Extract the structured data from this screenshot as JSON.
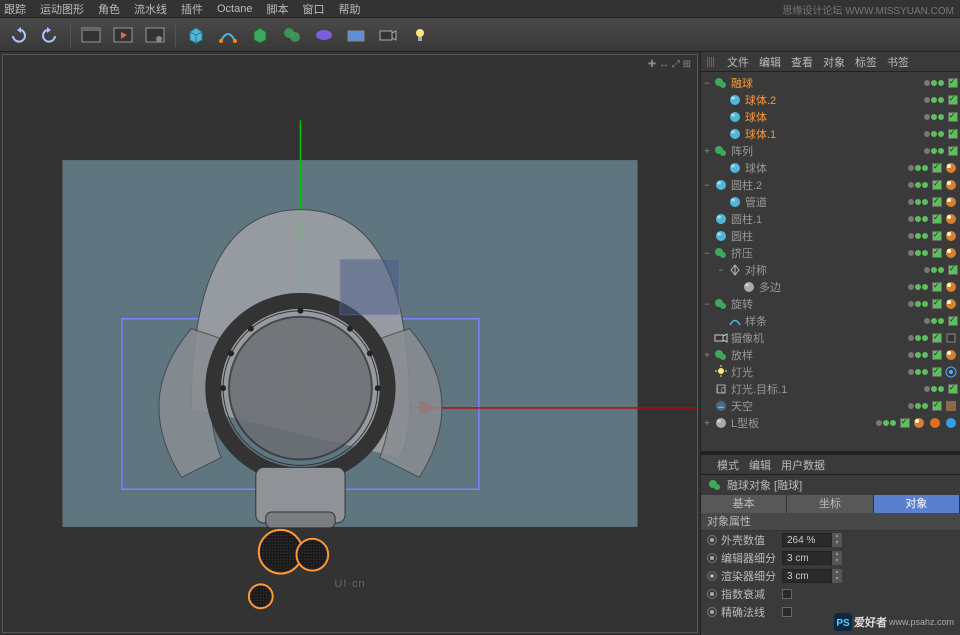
{
  "menu": [
    "跟踪",
    "运动图形",
    "角色",
    "流水线",
    "插件",
    "Octane",
    "脚本",
    "窗口",
    "帮助"
  ],
  "watermarks": {
    "top_right": "思缘设计论坛   WWW.MISSYUAN.COM",
    "bottom_brand": "PS",
    "bottom_text1": "爱好者",
    "bottom_text2": "www.psahz.com",
    "viewport": "UI·cn"
  },
  "viewport_corner": "✚ ↔ ⤢ ⊞",
  "objects_panel": {
    "tabs": [
      "文件",
      "编辑",
      "查看",
      "对象",
      "标签",
      "书签"
    ]
  },
  "tree": [
    {
      "depth": 1,
      "expand": "−",
      "icon": "metaball",
      "label": "融球",
      "sel": true,
      "green": true
    },
    {
      "depth": 2,
      "expand": "",
      "icon": "sphere",
      "label": "球体.2",
      "sel": true,
      "green": true
    },
    {
      "depth": 2,
      "expand": "",
      "icon": "sphere",
      "label": "球体",
      "sel": true,
      "green": true
    },
    {
      "depth": 2,
      "expand": "",
      "icon": "sphere",
      "label": "球体.1",
      "sel": true,
      "green": true
    },
    {
      "depth": 1,
      "expand": "+",
      "icon": "array",
      "label": "阵列",
      "green": true
    },
    {
      "depth": 2,
      "expand": "",
      "icon": "sphere",
      "label": "球体",
      "green": true,
      "tags": [
        "phong"
      ]
    },
    {
      "depth": 1,
      "expand": "−",
      "icon": "cylinder",
      "label": "圆柱.2",
      "green": true,
      "tags": [
        "phong"
      ]
    },
    {
      "depth": 2,
      "expand": "",
      "icon": "cylinder",
      "label": "管道",
      "green": true,
      "tags": [
        "phong"
      ]
    },
    {
      "depth": 1,
      "expand": "",
      "icon": "cylinder",
      "label": "圆柱.1",
      "green": true,
      "tags": [
        "phong"
      ]
    },
    {
      "depth": 1,
      "expand": "",
      "icon": "cylinder",
      "label": "圆柱",
      "green": true,
      "tags": [
        "phong"
      ]
    },
    {
      "depth": 1,
      "expand": "−",
      "icon": "extrude",
      "label": "挤压",
      "green": true,
      "tags": [
        "phong"
      ]
    },
    {
      "depth": 2,
      "expand": "−",
      "icon": "symmetry",
      "label": "对称",
      "green": true
    },
    {
      "depth": 3,
      "expand": "",
      "icon": "poly",
      "label": "多边",
      "green": true,
      "tags": [
        "phong"
      ]
    },
    {
      "depth": 1,
      "expand": "−",
      "icon": "lathe",
      "label": "旋转",
      "green": true,
      "tags": [
        "phong"
      ]
    },
    {
      "depth": 2,
      "expand": "",
      "icon": "spline",
      "label": "样条",
      "green": true
    },
    {
      "depth": 1,
      "expand": "",
      "icon": "camera",
      "label": "摄像机",
      "green": true,
      "tags": [
        "camtag"
      ]
    },
    {
      "depth": 1,
      "expand": "+",
      "icon": "sweep",
      "label": "放样",
      "green": true,
      "tags": [
        "phong"
      ]
    },
    {
      "depth": 1,
      "expand": "",
      "icon": "light",
      "label": "灯光",
      "green": true,
      "tags": [
        "target"
      ]
    },
    {
      "depth": 1,
      "expand": "",
      "icon": "null",
      "label": "灯光.目标.1",
      "green": true
    },
    {
      "depth": 1,
      "expand": "",
      "icon": "sky",
      "label": "天空",
      "green": true,
      "tags": [
        "mat"
      ]
    },
    {
      "depth": 1,
      "expand": "+",
      "icon": "poly",
      "label": "L型板",
      "green": true,
      "tags": [
        "phong",
        "orange",
        "blue"
      ]
    }
  ],
  "attr": {
    "tabs": [
      "模式",
      "编辑",
      "用户数据"
    ],
    "title": "融球对象 [融球]",
    "subtabs": [
      "基本",
      "坐标",
      "对象"
    ],
    "active_subtab": 2,
    "section": "对象属性",
    "rows": [
      {
        "label": "外壳数值",
        "value": "264 %",
        "type": "num"
      },
      {
        "label": "编辑器细分",
        "value": "3 cm",
        "type": "num"
      },
      {
        "label": "渲染器细分",
        "value": "3 cm",
        "type": "num"
      },
      {
        "label": "指数衰减",
        "type": "check"
      },
      {
        "label": "精确法线",
        "type": "check"
      }
    ]
  }
}
